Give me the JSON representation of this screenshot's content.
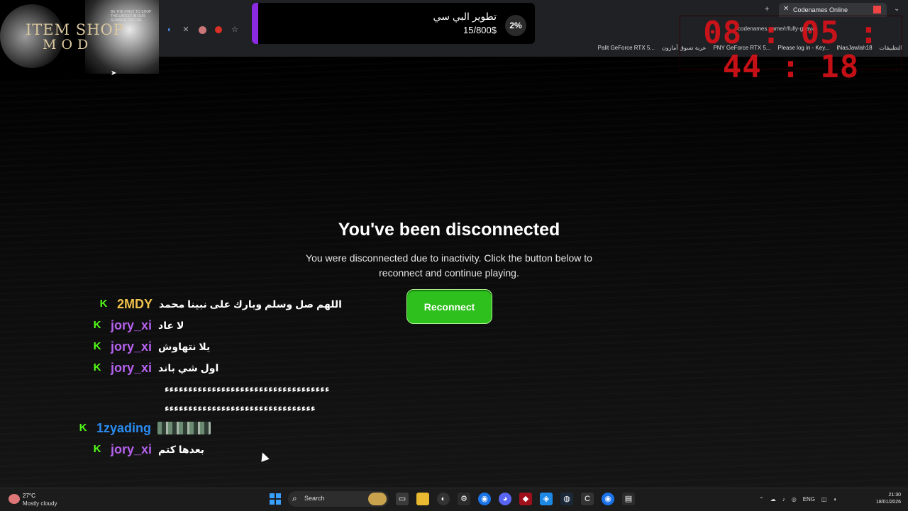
{
  "browser": {
    "tab_title": "Codenames Online",
    "address": "codenames.game/r/fully-guava",
    "bookmarks": [
      "التطبيقات",
      "INasJawlah18",
      "Please log in - Key...",
      "PNY GeForce RTX 5...",
      "عربة تسوق أمازون",
      "Palit GeForce RTX 5..."
    ]
  },
  "overlay": {
    "logo_line1": "ITEM SHOP",
    "logo_line2": "MOD",
    "logo_tagline": "BE THE FIRST TO SHOP THE LATEST IN OUR SUMMER SPECIAL",
    "goal_title": "تطوير البي سي",
    "goal_amount": "15/800$",
    "goal_percent": "2%",
    "goal_progress": 0.02,
    "timer": "08 : 05 : 44 : 18"
  },
  "dialog": {
    "title": "You've been disconnected",
    "message": "You were disconnected due to inactivity. Click the button below to reconnect and continue playing.",
    "button_label": "Reconnect"
  },
  "chat": {
    "badge": "K",
    "messages": [
      {
        "user": "2MDY",
        "color": "#f0c24b",
        "text": "اللهم صل وسلم وبارك على نبينا محمد"
      },
      {
        "user": "jory_xi",
        "color": "#b562ee",
        "text": "لا عاد"
      },
      {
        "user": "jory_xi",
        "color": "#b562ee",
        "text": "يلا نتهاوش"
      },
      {
        "user": "jory_xi",
        "color": "#b562ee",
        "text": "اول شي باند"
      },
      {
        "user": "1zyading",
        "color": "#2a8cf0",
        "text": ""
      },
      {
        "user": "jory_xi",
        "color": "#b562ee",
        "text": "بعدها كتم"
      }
    ],
    "continuation_1": "ءءءءءءءءءءءءءءءءءءءءءءءءءءءءءءءءءءء",
    "continuation_2": "ءءءءءءءءءءءءءءءءءءءءءءءءءءءءءءءء"
  },
  "taskbar": {
    "temperature": "27°C",
    "weather": "Mostly cloudy",
    "search_placeholder": "Search",
    "language": "ENG",
    "time": "21:30",
    "date": "18/01/2026"
  }
}
